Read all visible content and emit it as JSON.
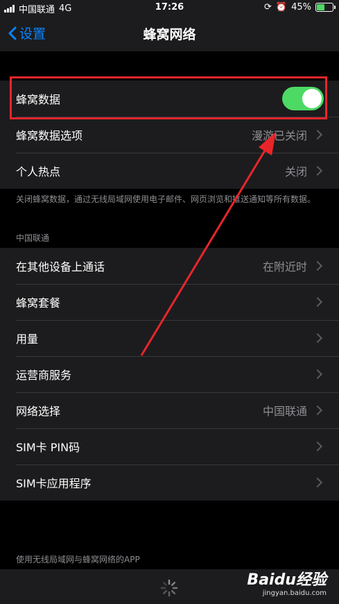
{
  "status_bar": {
    "carrier": "中国联通",
    "network": "4G",
    "time": "17:26",
    "battery_percent": "45%",
    "battery_level": 0.45
  },
  "nav": {
    "back_label": "设置",
    "title": "蜂窝网络"
  },
  "group1": [
    {
      "label": "蜂窝数据",
      "toggle_on": true
    },
    {
      "label": "蜂窝数据选项",
      "value": "漫游已关闭"
    },
    {
      "label": "个人热点",
      "value": "关闭"
    }
  ],
  "group1_footer": "关闭蜂窝数据，通过无线局域网使用电子邮件、网页浏览和推送通知等所有数据。",
  "section_header": "中国联通",
  "group2": [
    {
      "label": "在其他设备上通话",
      "value": "在附近时"
    },
    {
      "label": "蜂窝套餐",
      "value": ""
    },
    {
      "label": "用量",
      "value": ""
    },
    {
      "label": "运营商服务",
      "value": ""
    },
    {
      "label": "网络选择",
      "value": "中国联通"
    },
    {
      "label": "SIM卡 PIN码",
      "value": ""
    },
    {
      "label": "SIM卡应用程序",
      "value": ""
    }
  ],
  "bottom_header": "使用无线局域网与蜂窝网络的APP",
  "watermark": {
    "brand": "Baidu经验",
    "url": "jingyan.baidu.com"
  },
  "colors": {
    "accent": "#0a84ff",
    "toggle_on": "#4cd964",
    "annotation": "#e8262a"
  }
}
